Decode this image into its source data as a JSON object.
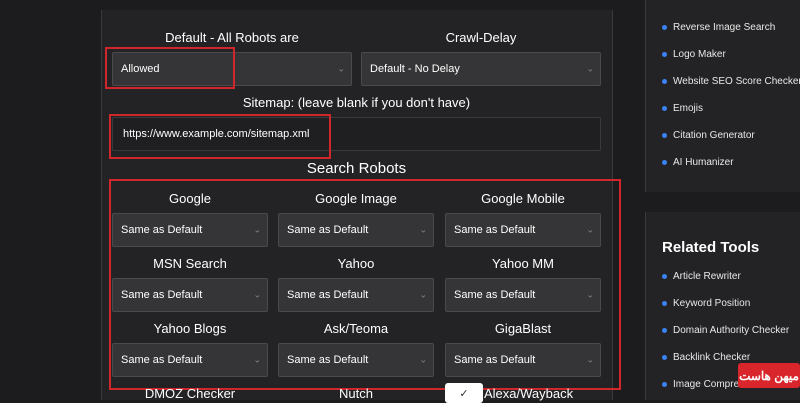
{
  "form": {
    "default_label": "Default - All Robots are",
    "default_value": "Allowed",
    "crawl_label": "Crawl-Delay",
    "crawl_value": "Default - No Delay",
    "sitemap_label": "Sitemap: (leave blank if you don't have)",
    "sitemap_value": "https://www.example.com/sitemap.xml",
    "search_robots_title": "Search Robots",
    "robots": [
      {
        "label": "Google",
        "value": "Same as Default"
      },
      {
        "label": "Google Image",
        "value": "Same as Default"
      },
      {
        "label": "Google Mobile",
        "value": "Same as Default"
      },
      {
        "label": "MSN Search",
        "value": "Same as Default"
      },
      {
        "label": "Yahoo",
        "value": "Same as Default"
      },
      {
        "label": "Yahoo MM",
        "value": "Same as Default"
      },
      {
        "label": "Yahoo Blogs",
        "value": "Same as Default"
      },
      {
        "label": "Ask/Teoma",
        "value": "Same as Default"
      },
      {
        "label": "GigaBlast",
        "value": "Same as Default"
      }
    ],
    "partial_row": [
      "DMOZ Checker",
      "Nutch",
      "Alexa/Wayback"
    ]
  },
  "sidebar": {
    "top_items": [
      "Reverse Image Search",
      "Logo Maker",
      "Website SEO Score Checker",
      "Emojis",
      "Citation Generator",
      "AI Humanizer"
    ],
    "related_heading": "Related Tools",
    "related_items": [
      "Article Rewriter",
      "Keyword Position",
      "Domain Authority Checker",
      "Backlink Checker",
      "Image Compressor"
    ]
  },
  "watermark": "میهن هاست",
  "colors": {
    "accent_red": "#d0272d",
    "bullet_blue": "#3b82f6",
    "bg": "#1c1c1e"
  }
}
